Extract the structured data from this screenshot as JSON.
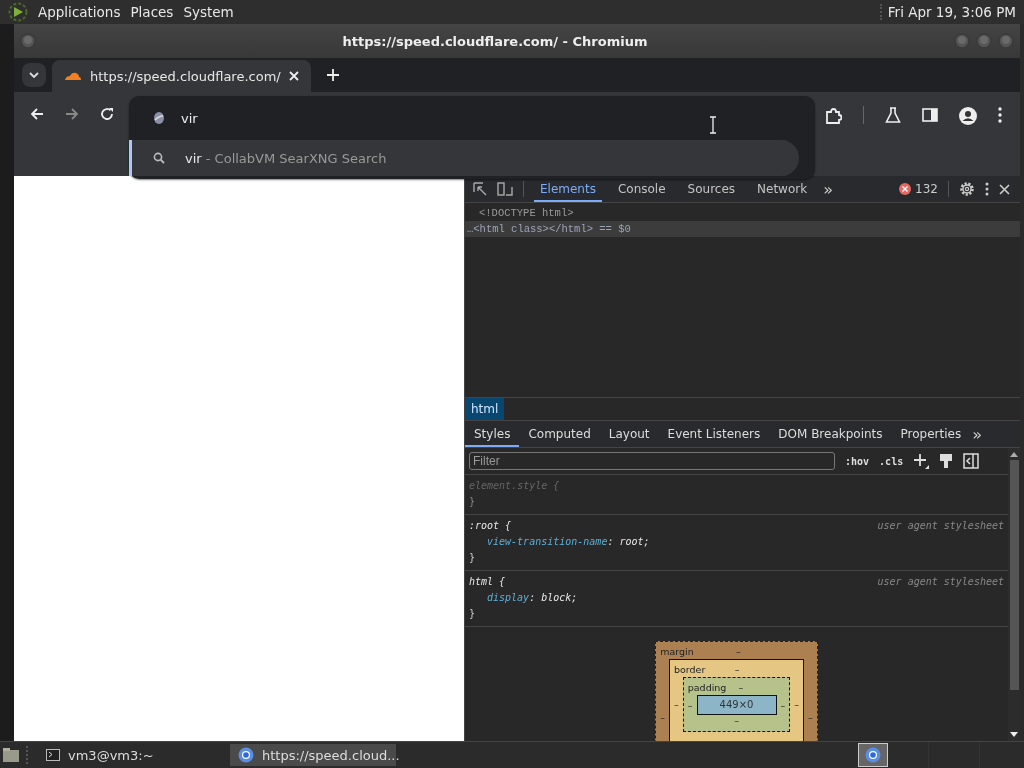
{
  "top_panel": {
    "menus": [
      "Applications",
      "Places",
      "System"
    ],
    "clock": "Fri Apr 19,  3:06 PM"
  },
  "window": {
    "title": "https://speed.cloudflare.com/ - Chromium"
  },
  "tabs": [
    {
      "label": "https://speed.cloudflare.com/",
      "selected": true
    }
  ],
  "omnibox": {
    "value": "vir",
    "suggestions": [
      {
        "query": "vir",
        "description": " - CollabVM SearXNG Search",
        "selected": true
      }
    ]
  },
  "devtools": {
    "tabs": [
      {
        "label": "Elements",
        "selected": true
      },
      {
        "label": "Console",
        "selected": false
      },
      {
        "label": "Sources",
        "selected": false
      },
      {
        "label": "Network",
        "selected": false
      }
    ],
    "more": "»",
    "error_count": "132",
    "dom_lines": [
      {
        "text": "<!DOCTYPE html>",
        "selected": false
      },
      {
        "text": "…<html class></html> == $0",
        "selected": true
      }
    ],
    "breadcrumb": "html",
    "panel_tabs": [
      {
        "label": "Styles",
        "selected": true
      },
      {
        "label": "Computed",
        "selected": false
      },
      {
        "label": "Layout",
        "selected": false
      },
      {
        "label": "Event Listeners",
        "selected": false
      },
      {
        "label": "DOM Breakpoints",
        "selected": false
      },
      {
        "label": "Properties",
        "selected": false
      }
    ],
    "filter_placeholder": "Filter",
    "style_buttons": [
      ":hov",
      ".cls"
    ],
    "rules": [
      {
        "selector": "element.style {",
        "dimmed": true,
        "close": "}"
      },
      {
        "selector": ":root {",
        "source": "user agent stylesheet",
        "dimmed": false,
        "declarations": [
          {
            "property": "view-transition-name",
            "rest": ": root;"
          }
        ],
        "close": "}"
      },
      {
        "selector": "html {",
        "source": "user agent stylesheet",
        "dimmed": false,
        "declarations": [
          {
            "property": "display",
            "rest": ": block;"
          }
        ],
        "close": "}"
      }
    ],
    "box_model": {
      "margin": {
        "label": "margin",
        "top": "–",
        "left": "–",
        "right": "–"
      },
      "border": {
        "label": "border",
        "top": "–",
        "left": "–",
        "right": "–"
      },
      "padding": {
        "label": "padding",
        "top": "–",
        "left": "–",
        "right": "–",
        "bottom": "–"
      },
      "content": "449×0"
    }
  },
  "taskbar": [
    {
      "label": "vm3@vm3:~",
      "kind": "terminal",
      "selected": false
    },
    {
      "label": "https://speed.cloud...",
      "kind": "browser",
      "selected": true
    }
  ]
}
